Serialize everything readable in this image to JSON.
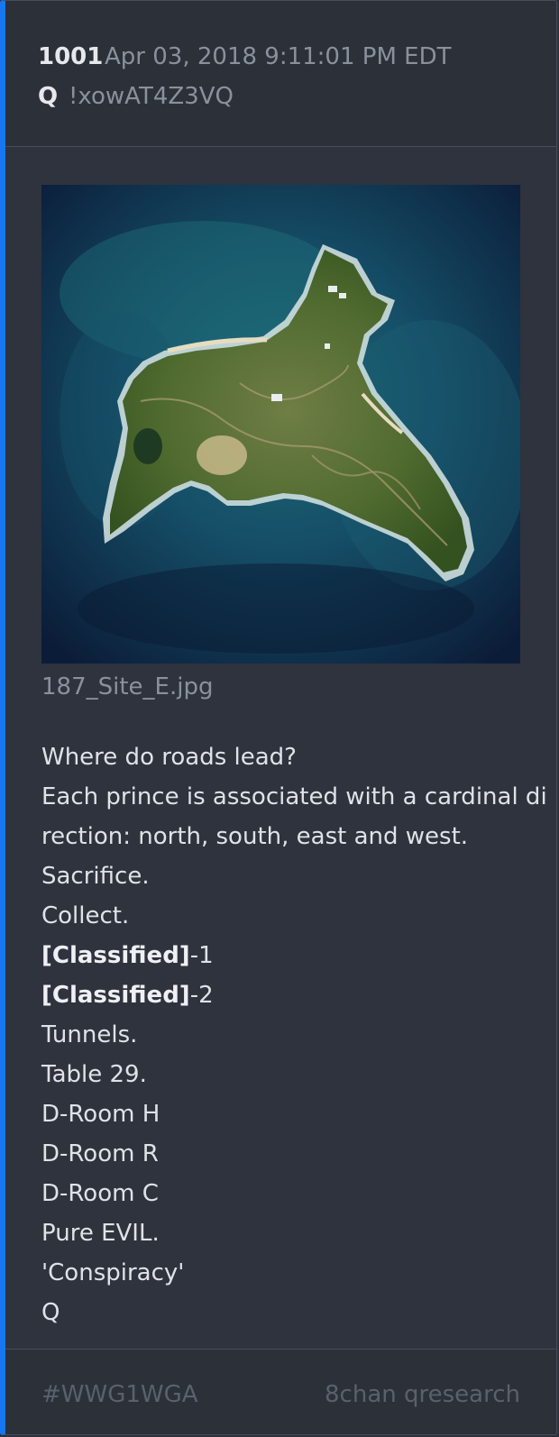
{
  "post": {
    "number": "1001",
    "date": "Apr 03, 2018 9:11:01 PM EDT",
    "author": "Q",
    "tripcode": "!xowAT4Z3VQ",
    "image_filename": "187_Site_E.jpg",
    "lines": [
      "Where do roads lead?",
      "Each prince is associated with a cardinal di",
      "rection: north, south, east and west.",
      "Sacrifice.",
      "Collect.",
      {
        "bold": "[Classified]",
        "rest": "-1"
      },
      {
        "bold": "[Classified]",
        "rest": "-2"
      },
      "Tunnels.",
      "Table 29.",
      "D-Room H",
      "D-Room R",
      "D-Room C",
      "Pure EVIL.",
      "'Conspiracy'",
      "Q"
    ]
  },
  "footer": {
    "hashtag": "#WWG1WGA",
    "board": "8chan qresearch"
  },
  "colors": {
    "accent": "#1777f2",
    "card_bg": "#2e333e",
    "header_bg": "#2b3039",
    "text": "#dfe2e7",
    "muted": "#8b919c",
    "footer_text": "#5a616c"
  },
  "icons": {
    "image": "aerial-island-photo"
  }
}
